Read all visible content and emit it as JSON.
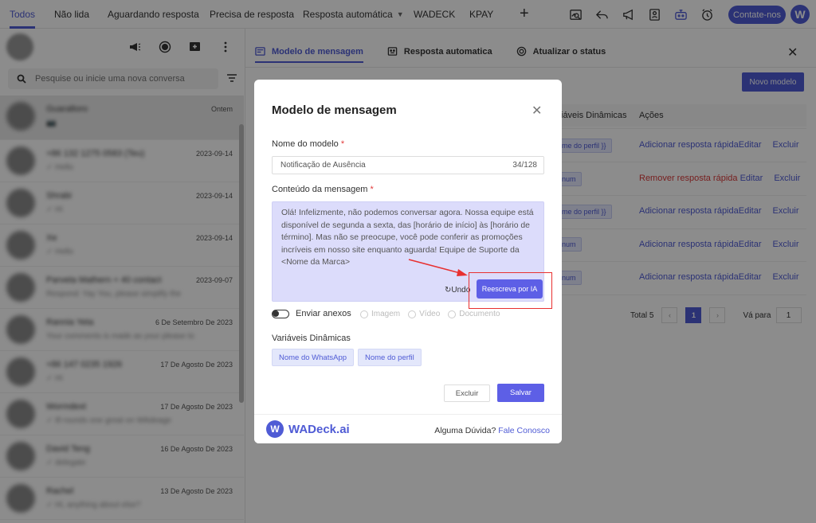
{
  "topnav": {
    "tabs": [
      {
        "label": "Todos"
      },
      {
        "label": "Não lida"
      },
      {
        "label": "Aguardando resposta"
      },
      {
        "label": "Precisa de resposta"
      },
      {
        "label": "Resposta automática"
      },
      {
        "label": "WADECK"
      },
      {
        "label": "KPAY"
      }
    ],
    "contact_label": "Contate-nos",
    "logo_letter": "W",
    "icons": [
      "image-search-icon",
      "reply-icon",
      "megaphone-icon",
      "contact-card-icon",
      "robot-icon",
      "alarm-clock-icon"
    ]
  },
  "sidebar": {
    "search_placeholder": "Pesquise ou inicie uma nova conversa",
    "conversations": [
      {
        "name": "Guaraltoro",
        "message": "📷",
        "date": "Ontem"
      },
      {
        "name": "+86 132 1275 0583 (Teu)",
        "message": "✓ Hello",
        "date": "2023-09-14"
      },
      {
        "name": "Shrabi",
        "message": "✓ Hi",
        "date": "2023-09-14"
      },
      {
        "name": "Xe",
        "message": "✓ Hello",
        "date": "2023-09-14"
      },
      {
        "name": "Parveta Mathern + 40 contact",
        "message": "Respond: Yay You, please simplify the",
        "date": "2023-09-07"
      },
      {
        "name": "Rannia Yeta",
        "message": "Your comments is made as your please to",
        "date": "6 De Setembro De 2023"
      },
      {
        "name": "+86 147 0235 1926",
        "message": "✓ Hi",
        "date": "17 De Agosto De 2023"
      },
      {
        "name": "Wormdext",
        "message": "✓ Ill rounds one great on WAdeage",
        "date": "17 De Agosto De 2023"
      },
      {
        "name": "David Teng",
        "message": "✓ delegate",
        "date": "16 De Agosto De 2023"
      },
      {
        "name": "Rachel",
        "message": "✓ Hi, anything about else?",
        "date": "13 De Agosto De 2023"
      }
    ]
  },
  "panel": {
    "tabs": [
      {
        "label": "Modelo de mensagem"
      },
      {
        "label": "Resposta automatica"
      },
      {
        "label": "Atualizar o status"
      }
    ],
    "new_button": "Novo modelo",
    "col_vars": "iáveis Dinâmicas",
    "col_actions": "Ações",
    "rows": [
      {
        "chip": "me do perfil }}",
        "action1": "Adicionar resposta rápida",
        "action1_red": false,
        "edit": "Editar",
        "delete": "Excluir"
      },
      {
        "chip": "num",
        "action1": "Remover resposta rápida",
        "action1_red": true,
        "edit": "Editar",
        "delete": "Excluir"
      },
      {
        "chip": "me do perfil }}",
        "action1": "Adicionar resposta rápida",
        "action1_red": false,
        "edit": "Editar",
        "delete": "Excluir"
      },
      {
        "chip": "num",
        "action1": "Adicionar resposta rápida",
        "action1_red": false,
        "edit": "Editar",
        "delete": "Excluir"
      },
      {
        "chip": "num",
        "action1": "Adicionar resposta rápida",
        "action1_red": false,
        "edit": "Editar",
        "delete": "Excluir"
      }
    ],
    "pagination": {
      "total": "Total 5",
      "current": "1",
      "goto": "Vá para",
      "goto_value": "1"
    }
  },
  "modal": {
    "title": "Modelo de mensagem",
    "name_label": "Nome do modelo",
    "required_mark": "*",
    "name_value": "Notificação de Ausência",
    "name_counter": "34/128",
    "content_label": "Conteúdo da mensagem",
    "content_value": "Olá! Infelizmente, não podemos conversar agora. Nossa equipe está disponível de segunda a sexta, das [horário de início] às [horário de término]. Mas não se preocupe, você pode conferir as promoções incríveis em nosso site enquanto aguarda! Equipe de Suporte da <Nome da Marca>",
    "undo_label": "Undo",
    "ai_button": "Reescreva por IA",
    "attach_label": "Enviar anexos",
    "attach_options": [
      {
        "label": "Imagem"
      },
      {
        "label": "Vídeo"
      },
      {
        "label": "Documento"
      }
    ],
    "vars_label": "Variáveis Dinâmicas",
    "vars": [
      {
        "label": "Nome do WhatsApp"
      },
      {
        "label": "Nome do perfil"
      }
    ],
    "cancel_button": "Excluir",
    "save_button": "Salvar",
    "brand_name": "WADeck.ai",
    "brand_letter": "W",
    "help_text": "Alguma Dúvida?",
    "help_link": "Fale Conosco"
  }
}
